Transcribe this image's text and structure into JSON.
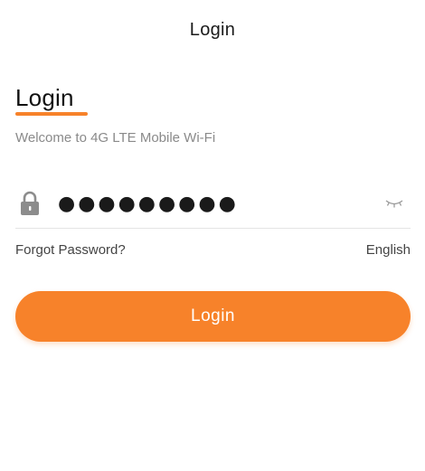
{
  "header": {
    "title": "Login"
  },
  "form": {
    "heading": "Login",
    "subtitle": "Welcome to 4G LTE Mobile Wi-Fi",
    "password_value": "●●●●●●●●●",
    "forgot_password_label": "Forgot Password?",
    "language_label": "English",
    "login_button_label": "Login"
  },
  "icons": {
    "lock": "lock-icon",
    "eye": "eye-closed-icon"
  },
  "colors": {
    "accent": "#f7822a",
    "subtitle": "#8a8a8a",
    "divider": "#e4e4e4"
  }
}
